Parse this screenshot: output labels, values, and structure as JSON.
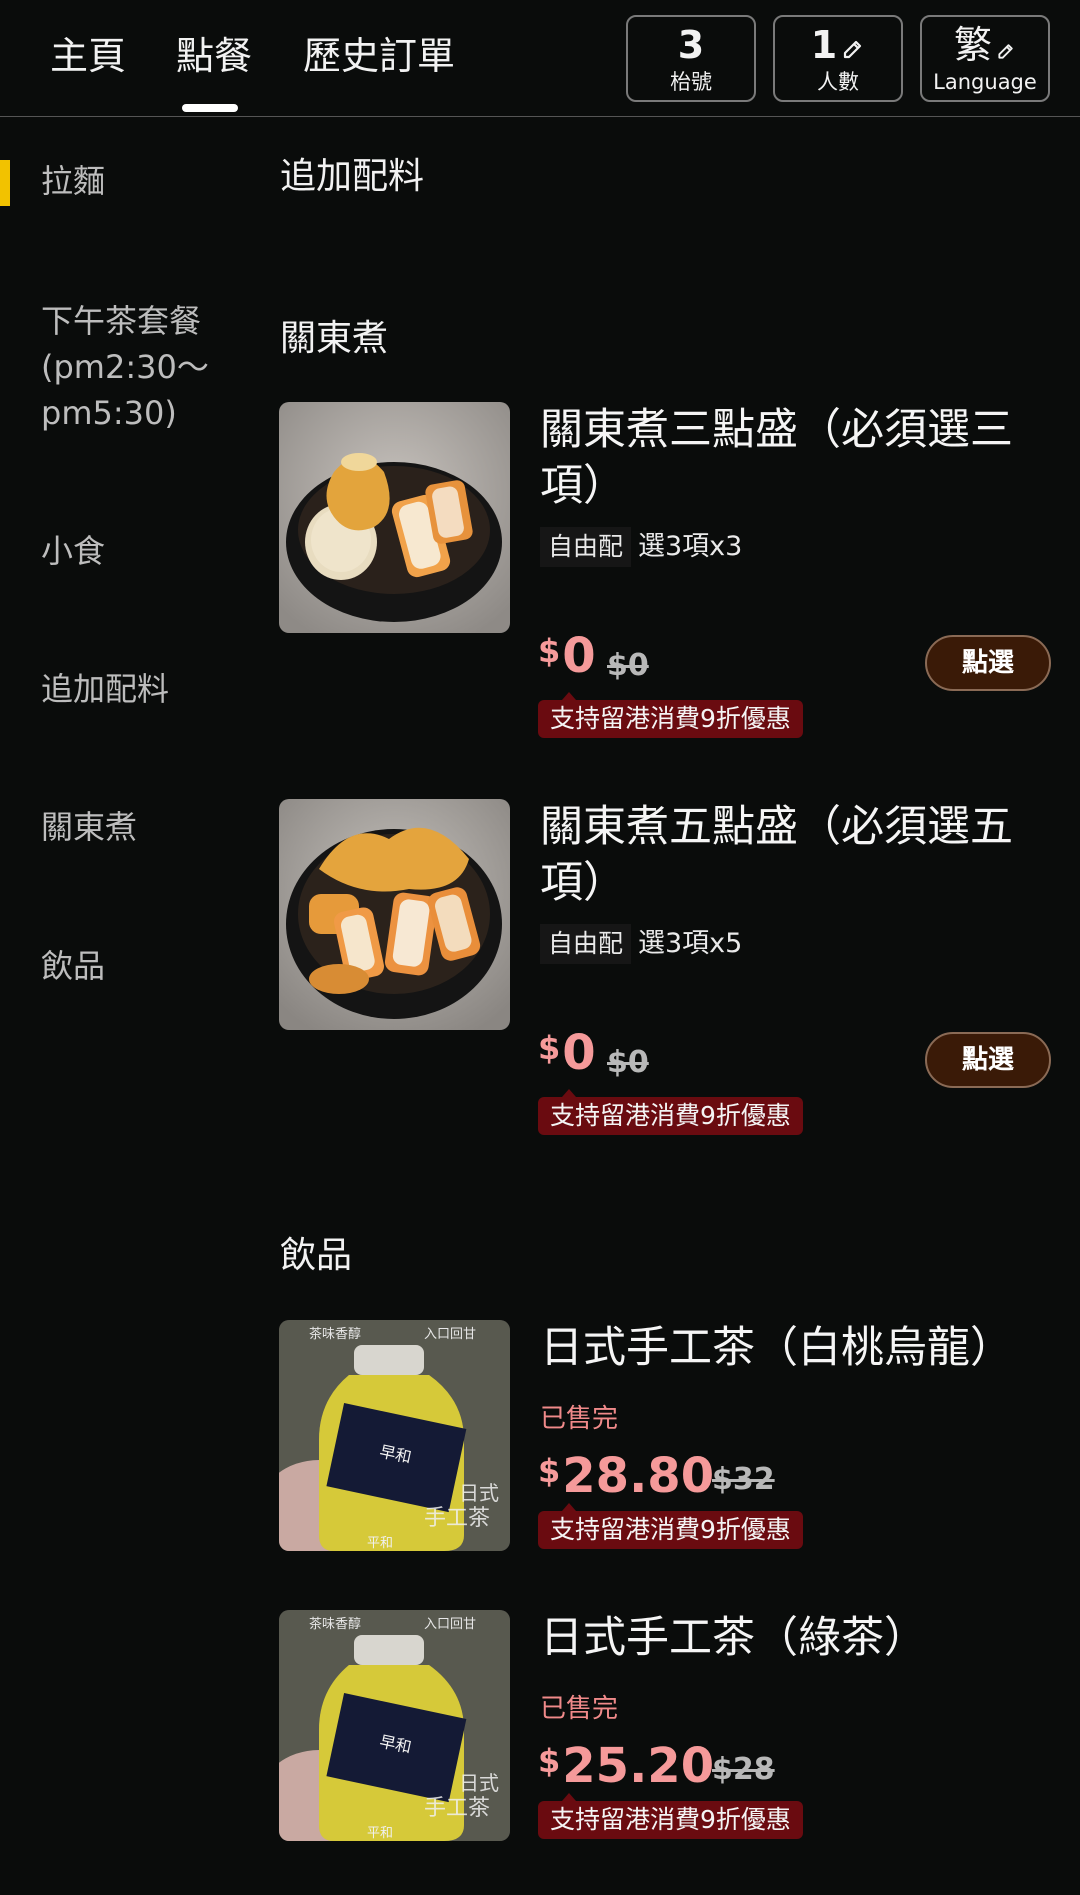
{
  "nav": {
    "tabs": [
      "主頁",
      "點餐",
      "歷史訂單"
    ],
    "active_tab": "點餐"
  },
  "header_buttons": {
    "table": {
      "value": "3",
      "label": "枱號"
    },
    "people": {
      "value": "1",
      "label": "人數"
    },
    "language": {
      "value": "繁",
      "label": "Language"
    }
  },
  "sidebar": {
    "items": [
      {
        "label": "拉麵"
      },
      {
        "label": "下午茶套餐(pm2:30～pm5:30)"
      },
      {
        "label": "小食"
      },
      {
        "label": "追加配料"
      },
      {
        "label": "關東煮"
      },
      {
        "label": "飲品"
      }
    ],
    "active_index": 0
  },
  "sections": [
    {
      "title": "追加配料",
      "items": []
    },
    {
      "title": "關東煮",
      "items": [
        {
          "name": "關東煮三點盛（必須選三項）",
          "tag": "自由配",
          "choose": "選3項x3",
          "currency": "$",
          "price": "0",
          "old_price": "$0",
          "promo": "支持留港消費9折優惠",
          "button": "點選"
        },
        {
          "name": "關東煮五點盛（必須選五項）",
          "tag": "自由配",
          "choose": "選3項x5",
          "currency": "$",
          "price": "0",
          "old_price": "$0",
          "promo": "支持留港消費9折優惠",
          "button": "點選"
        }
      ]
    },
    {
      "title": "飲品",
      "items": [
        {
          "name": "日式手工茶（白桃烏龍）",
          "status": "已售完",
          "currency": "$",
          "price": "28.80",
          "old_price": "$32",
          "promo": "支持留港消費9折優惠"
        },
        {
          "name": "日式手工茶（綠茶）",
          "status": "已售完",
          "currency": "$",
          "price": "25.20",
          "old_price": "$28",
          "promo": "支持留港消費9折優惠"
        }
      ]
    }
  ],
  "thumb_texts": {
    "tea_top_left": "茶味香醇",
    "tea_top_right": "入口回甘",
    "tea_label": "早和",
    "tea_brand_line1": "日式",
    "tea_brand_line2": "手工茶",
    "tea_footer": "平和"
  },
  "colors": {
    "background": "#0a0c0b",
    "accent_yellow": "#f2c200",
    "price_pink": "#f59a9a",
    "promo_red": "#6a0b10",
    "select_button": "#3a1a07"
  }
}
